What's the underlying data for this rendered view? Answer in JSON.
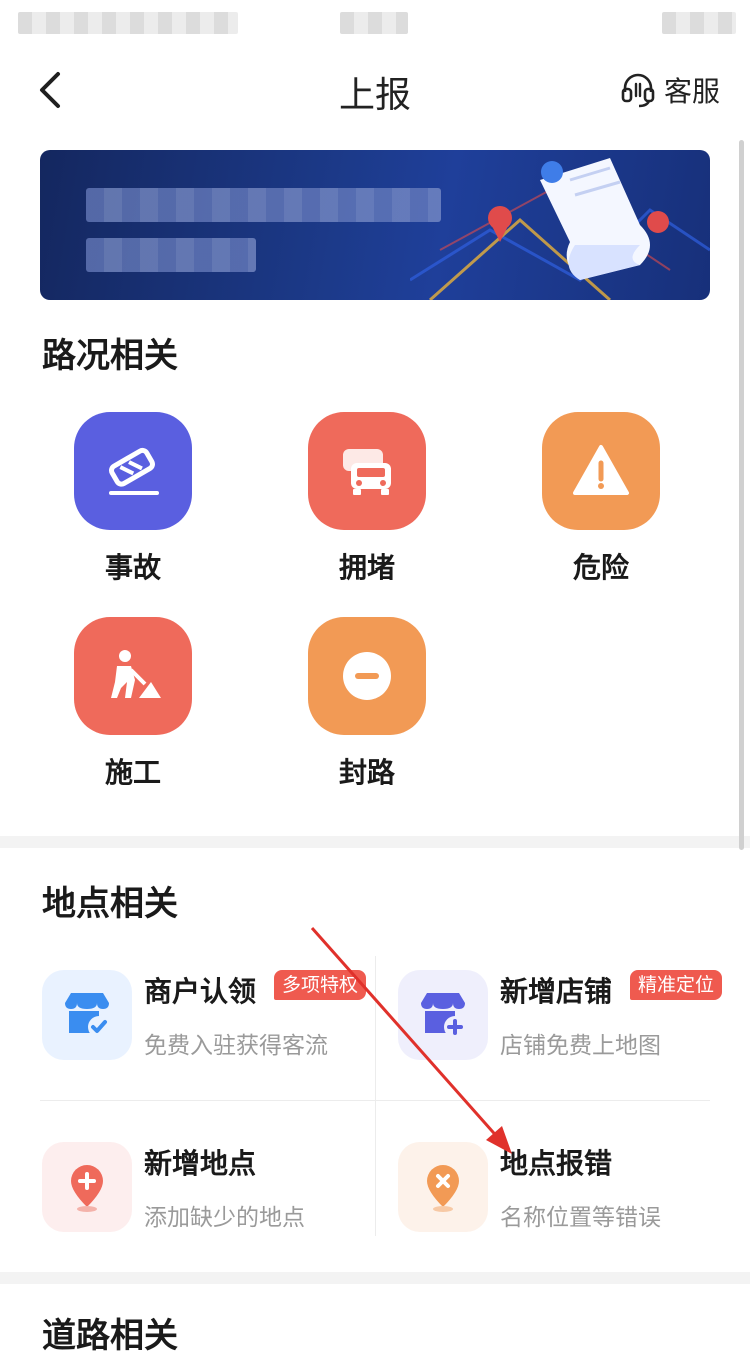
{
  "navbar": {
    "title": "上报",
    "service_label": "客服"
  },
  "sections": {
    "road": {
      "title": "路况相关",
      "items": [
        {
          "label": "事故",
          "icon": "accident-car-icon",
          "color": "#5a5fe0"
        },
        {
          "label": "拥堵",
          "icon": "traffic-jam-icon",
          "color": "#ef6a5b"
        },
        {
          "label": "危险",
          "icon": "warning-icon",
          "color": "#f29a55"
        },
        {
          "label": "施工",
          "icon": "construction-worker-icon",
          "color": "#ef6a5b"
        },
        {
          "label": "封路",
          "icon": "road-closed-icon",
          "color": "#f29a55"
        }
      ]
    },
    "place": {
      "title": "地点相关",
      "items": [
        {
          "title": "商户认领",
          "subtitle": "免费入驻获得客流",
          "badge": "多项特权",
          "icon": "shop-claim-icon"
        },
        {
          "title": "新增店铺",
          "subtitle": "店铺免费上地图",
          "badge": "精准定位",
          "icon": "add-shop-icon"
        },
        {
          "title": "新增地点",
          "subtitle": "添加缺少的地点",
          "icon": "add-location-icon"
        },
        {
          "title": "地点报错",
          "subtitle": "名称位置等错误",
          "icon": "location-error-icon"
        }
      ]
    },
    "roadway": {
      "title": "道路相关"
    }
  },
  "colors": {
    "accent_red": "#ef5a4f",
    "purple": "#5a5fe0",
    "orange": "#f29a55",
    "annotation_arrow": "#e0312b"
  }
}
